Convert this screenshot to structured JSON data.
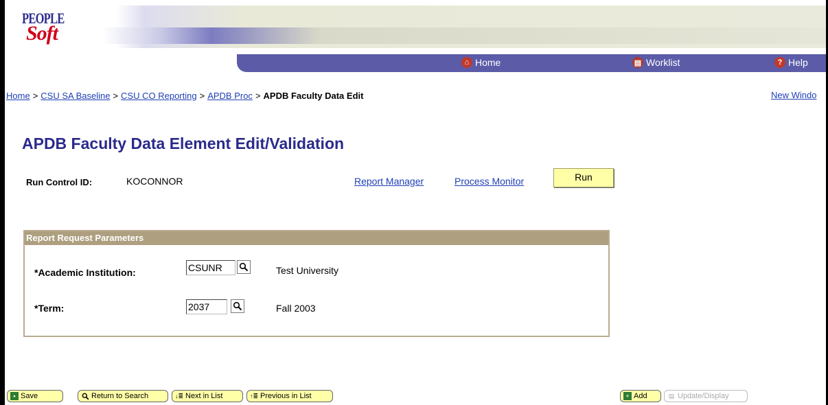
{
  "header": {
    "logo_top": "PEOPLE",
    "logo_bottom": "Soft",
    "nav": [
      {
        "label": "Home",
        "icon": "home-icon"
      },
      {
        "label": "Worklist",
        "icon": "worklist-icon"
      },
      {
        "label": "Help",
        "icon": "help-icon"
      }
    ]
  },
  "breadcrumb": {
    "items": [
      "Home",
      "CSU SA Baseline",
      "CSU CO Reporting",
      "APDB Proc"
    ],
    "separator": ">",
    "current": "APDB Faculty Data Edit"
  },
  "new_window": "New Windo",
  "page_title": "APDB Faculty Data Element Edit/Validation",
  "run_control": {
    "label": "Run Control ID:",
    "value": "KOCONNOR",
    "report_manager": "Report Manager",
    "process_monitor": "Process Monitor",
    "run_label": "Run"
  },
  "params": {
    "header": "Report Request Parameters",
    "institution": {
      "label": "*Academic Institution:",
      "value": "CSUNR",
      "description": "Test University"
    },
    "term": {
      "label": "*Term:",
      "value": "2037",
      "description": "Fall 2003"
    }
  },
  "toolbar": {
    "save": "Save",
    "return_to_search": "Return to Search",
    "next_in_list": "Next in List",
    "previous_in_list": "Previous in List",
    "add": "Add",
    "update_display": "Update/Display"
  },
  "colors": {
    "navbar": "#5b5ba8",
    "title": "#2a2a8c",
    "link": "#1f3fb5",
    "group_header": "#ad9f7f",
    "button": "#ffffa8"
  }
}
